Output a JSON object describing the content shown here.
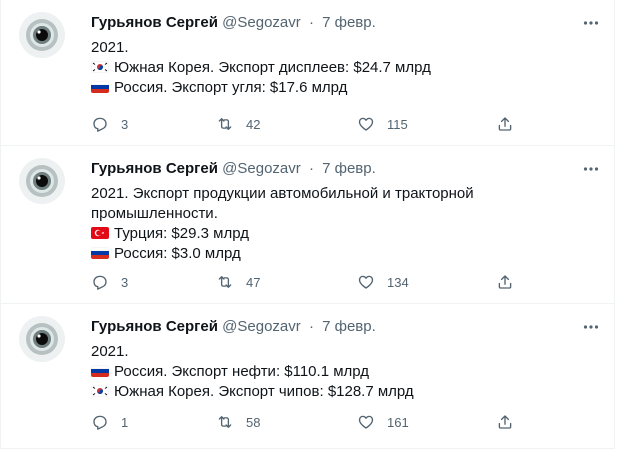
{
  "tweets": [
    {
      "author": "Гурьянов Сергей",
      "handle": "@Segozavr",
      "separator": "·",
      "date": "7 февр.",
      "lines": [
        {
          "flag": "",
          "text": "2021."
        },
        {
          "flag": "south-korea-flag-icon",
          "text": "Южная Корея. Экспорт дисплеев: $24.7 млрд"
        },
        {
          "flag": "russia-flag-icon",
          "text": "Россия. Экспорт угля: $17.6 млрд"
        }
      ],
      "replies": "3",
      "retweets": "42",
      "likes": "115"
    },
    {
      "author": "Гурьянов Сергей",
      "handle": "@Segozavr",
      "separator": "·",
      "date": "7 февр.",
      "lines": [
        {
          "flag": "",
          "text": "2021. Экспорт продукции автомобильной и тракторной"
        },
        {
          "flag": "",
          "text": "промышленности."
        },
        {
          "flag": "turkey-flag-icon",
          "text": "Турция: $29.3 млрд"
        },
        {
          "flag": "russia-flag-icon",
          "text": "Россия: $3.0 млрд"
        }
      ],
      "replies": "3",
      "retweets": "47",
      "likes": "134"
    },
    {
      "author": "Гурьянов Сергей",
      "handle": "@Segozavr",
      "separator": "·",
      "date": "7 февр.",
      "lines": [
        {
          "flag": "",
          "text": "2021."
        },
        {
          "flag": "russia-flag-icon",
          "text": "Россия. Экспорт нефти: $110.1 млрд"
        },
        {
          "flag": "south-korea-flag-icon",
          "text": "Южная Корея. Экспорт чипов: $128.7 млрд"
        }
      ],
      "replies": "1",
      "retweets": "58",
      "likes": "161"
    }
  ],
  "icons": {
    "reply": "reply-icon",
    "retweet": "retweet-icon",
    "like": "heart-icon",
    "share": "share-icon",
    "more": "more-icon",
    "avatar": "eye-avatar"
  },
  "colors": {
    "text": "#0f1419",
    "muted": "#536471",
    "border": "#eff3f4"
  }
}
